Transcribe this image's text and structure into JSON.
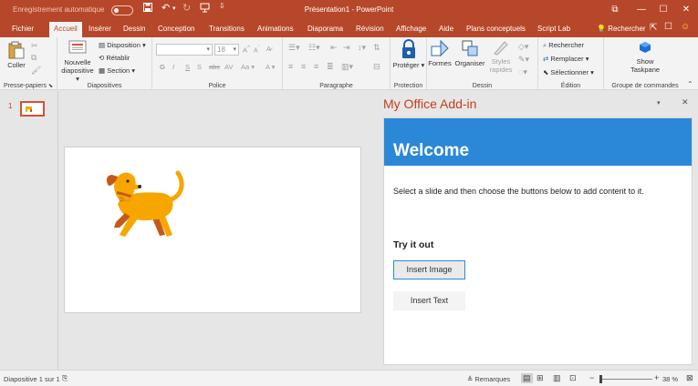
{
  "titlebar": {
    "autosave_label": "Enregistrement automatique",
    "toggle_state": "off",
    "document_title": "Présentation1 - PowerPoint",
    "icons": [
      "save-icon",
      "undo-icon",
      "redo-icon",
      "start-from-beginning-icon",
      "customize-qat-icon"
    ],
    "window_icons": [
      "ribbon-display-options-icon",
      "minimize-icon",
      "maximize-icon",
      "close-icon"
    ]
  },
  "tabs": [
    "Fichier",
    "Accueil",
    "Insérer",
    "Dessin",
    "Conception",
    "Transitions",
    "Animations",
    "Diaporama",
    "Révision",
    "Affichage",
    "Aide",
    "Plans conceptuels",
    "Script Lab"
  ],
  "active_tab": "Accueil",
  "tell_me": "Rechercher",
  "ribbon": {
    "clipboard": {
      "label": "Presse-papiers",
      "paste": "Coller"
    },
    "slides": {
      "label": "Diapositives",
      "new_slide_line1": "Nouvelle",
      "new_slide_line2": "diapositive",
      "layout": "Disposition",
      "reset": "Rétablir",
      "section": "Section"
    },
    "font": {
      "label": "Police",
      "font_size": "18",
      "bold": "G",
      "italic": "I",
      "underline": "S",
      "shadow": "S",
      "strike": "abc",
      "spacing": "AV",
      "case": "Aa",
      "grow": "A",
      "shrink": "A",
      "color": "A"
    },
    "paragraph": {
      "label": "Paragraphe"
    },
    "protection": {
      "label": "Protection",
      "protect": "Protéger"
    },
    "drawing": {
      "label": "Dessin",
      "shapes": "Formes",
      "arrange": "Organiser",
      "styles_line1": "Styles",
      "styles_line2": "rapides"
    },
    "editing": {
      "label": "Édition",
      "find": "Rechercher",
      "replace": "Remplacer",
      "select": "Sélectionner"
    },
    "commands": {
      "label": "Groupe de commandes",
      "show_line1": "Show",
      "show_line2": "Taskpane"
    }
  },
  "thumbnails": {
    "slide_number": "1"
  },
  "taskpane": {
    "title": "My Office Add-in",
    "welcome": "Welcome",
    "instructions": "Select a slide and then choose the buttons below to add content to it.",
    "try_heading": "Try it out",
    "insert_image": "Insert Image",
    "insert_text": "Insert Text"
  },
  "statusbar": {
    "slide_info": "Diapositive 1 sur 1",
    "notes": "Remarques",
    "zoom": "38 %"
  },
  "colors": {
    "brand": "#b7472a",
    "accent": "#c43e1c",
    "welcome_bg": "#2b88d8",
    "dog_orange": "#f7a600",
    "dog_dark": "#c25a1c"
  }
}
